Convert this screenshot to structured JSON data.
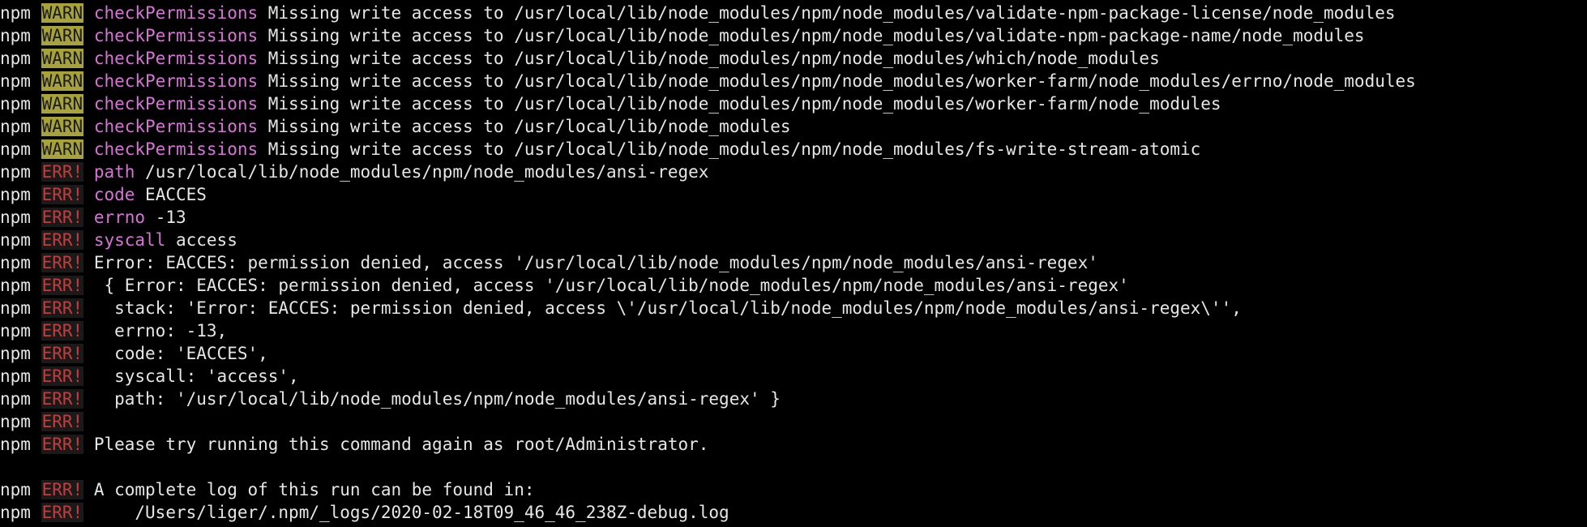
{
  "colors": {
    "background": "#000000",
    "text": "#e6e6e6",
    "warn_bg": "#a7a33a",
    "warn_fg": "#1b1b1b",
    "err_fg": "#c43d3d",
    "key": "#d873d8"
  },
  "lines": [
    {
      "prefix": "npm",
      "level": "WARN",
      "key": "checkPermissions",
      "text": " Missing write access to /usr/local/lib/node_modules/npm/node_modules/validate-npm-package-license/node_modules"
    },
    {
      "prefix": "npm",
      "level": "WARN",
      "key": "checkPermissions",
      "text": " Missing write access to /usr/local/lib/node_modules/npm/node_modules/validate-npm-package-name/node_modules"
    },
    {
      "prefix": "npm",
      "level": "WARN",
      "key": "checkPermissions",
      "text": " Missing write access to /usr/local/lib/node_modules/npm/node_modules/which/node_modules"
    },
    {
      "prefix": "npm",
      "level": "WARN",
      "key": "checkPermissions",
      "text": " Missing write access to /usr/local/lib/node_modules/npm/node_modules/worker-farm/node_modules/errno/node_modules"
    },
    {
      "prefix": "npm",
      "level": "WARN",
      "key": "checkPermissions",
      "text": " Missing write access to /usr/local/lib/node_modules/npm/node_modules/worker-farm/node_modules"
    },
    {
      "prefix": "npm",
      "level": "WARN",
      "key": "checkPermissions",
      "text": " Missing write access to /usr/local/lib/node_modules"
    },
    {
      "prefix": "npm",
      "level": "WARN",
      "key": "checkPermissions",
      "text": " Missing write access to /usr/local/lib/node_modules/npm/node_modules/fs-write-stream-atomic"
    },
    {
      "prefix": "npm",
      "level": "ERR!",
      "key": "path",
      "text": " /usr/local/lib/node_modules/npm/node_modules/ansi-regex"
    },
    {
      "prefix": "npm",
      "level": "ERR!",
      "key": "code",
      "text": " EACCES"
    },
    {
      "prefix": "npm",
      "level": "ERR!",
      "key": "errno",
      "text": " -13"
    },
    {
      "prefix": "npm",
      "level": "ERR!",
      "key": "syscall",
      "text": " access"
    },
    {
      "prefix": "npm",
      "level": "ERR!",
      "key": "",
      "text": "Error: EACCES: permission denied, access '/usr/local/lib/node_modules/npm/node_modules/ansi-regex'"
    },
    {
      "prefix": "npm",
      "level": "ERR!",
      "key": "",
      "text": " { Error: EACCES: permission denied, access '/usr/local/lib/node_modules/npm/node_modules/ansi-regex'"
    },
    {
      "prefix": "npm",
      "level": "ERR!",
      "key": "",
      "text": "  stack: 'Error: EACCES: permission denied, access \\'/usr/local/lib/node_modules/npm/node_modules/ansi-regex\\'',"
    },
    {
      "prefix": "npm",
      "level": "ERR!",
      "key": "",
      "text": "  errno: -13,"
    },
    {
      "prefix": "npm",
      "level": "ERR!",
      "key": "",
      "text": "  code: 'EACCES',"
    },
    {
      "prefix": "npm",
      "level": "ERR!",
      "key": "",
      "text": "  syscall: 'access',"
    },
    {
      "prefix": "npm",
      "level": "ERR!",
      "key": "",
      "text": "  path: '/usr/local/lib/node_modules/npm/node_modules/ansi-regex' }"
    },
    {
      "prefix": "npm",
      "level": "ERR!",
      "key": "",
      "text": ""
    },
    {
      "prefix": "npm",
      "level": "ERR!",
      "key": "",
      "text": "Please try running this command again as root/Administrator."
    },
    {
      "prefix": "",
      "level": "",
      "key": "",
      "text": ""
    },
    {
      "prefix": "npm",
      "level": "ERR!",
      "key": "",
      "text": "A complete log of this run can be found in:"
    },
    {
      "prefix": "npm",
      "level": "ERR!",
      "key": "",
      "text": "    /Users/liger/.npm/_logs/2020-02-18T09_46_46_238Z-debug.log"
    }
  ]
}
